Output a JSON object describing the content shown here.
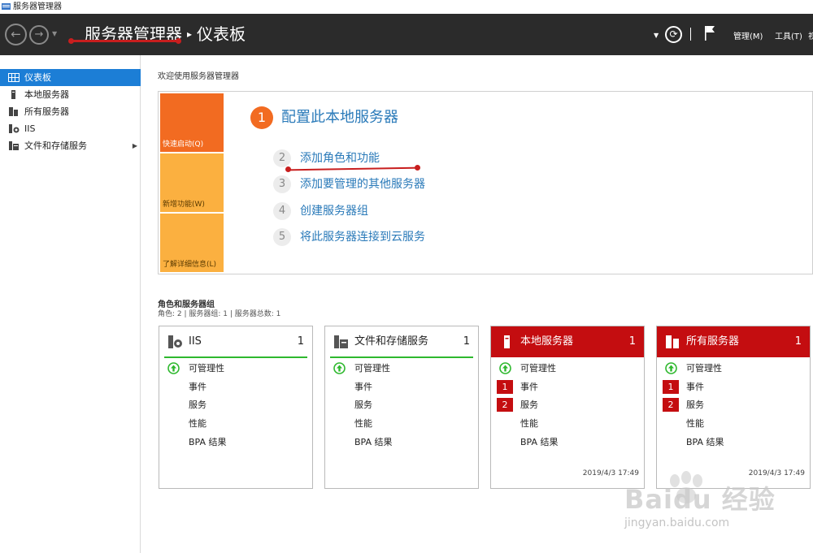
{
  "window": {
    "title": "服务器管理器"
  },
  "header": {
    "breadcrumb_root": "服务器管理器",
    "breadcrumb_sep": "▸",
    "breadcrumb_current": "仪表板",
    "menu_manage": "管理(M)",
    "menu_tools": "工具(T)",
    "menu_more": "视"
  },
  "sidebar": {
    "items": [
      {
        "label": "仪表板",
        "icon": "dashboard-icon",
        "active": true
      },
      {
        "label": "本地服务器",
        "icon": "server-icon"
      },
      {
        "label": "所有服务器",
        "icon": "servers-icon"
      },
      {
        "label": "IIS",
        "icon": "iis-icon"
      },
      {
        "label": "文件和存储服务",
        "icon": "storage-icon",
        "has_submenu": true
      }
    ]
  },
  "welcome": {
    "title": "欢迎使用服务器管理器",
    "tiles": {
      "quick_start": "快速启动(Q)",
      "whats_new": "新增功能(W)",
      "learn_more": "了解详细信息(L)"
    },
    "step1": {
      "num": "1",
      "label": "配置此本地服务器"
    },
    "steps": [
      {
        "num": "2",
        "label": "添加角色和功能"
      },
      {
        "num": "3",
        "label": "添加要管理的其他服务器"
      },
      {
        "num": "4",
        "label": "创建服务器组"
      },
      {
        "num": "5",
        "label": "将此服务器连接到云服务"
      }
    ]
  },
  "roles": {
    "title": "角色和服务器组",
    "summary": "角色: 2 | 服务器组: 1 | 服务器总数: 1",
    "cards": [
      {
        "name": "IIS",
        "count": "1",
        "status": "ok",
        "rows": [
          "可管理性",
          "事件",
          "服务",
          "性能",
          "BPA 结果"
        ],
        "badges": [
          "",
          "",
          "",
          "",
          ""
        ],
        "time": ""
      },
      {
        "name": "文件和存储服务",
        "count": "1",
        "status": "ok",
        "rows": [
          "可管理性",
          "事件",
          "服务",
          "性能",
          "BPA 结果"
        ],
        "badges": [
          "",
          "",
          "",
          "",
          ""
        ],
        "time": ""
      },
      {
        "name": "本地服务器",
        "count": "1",
        "status": "alert",
        "rows": [
          "可管理性",
          "事件",
          "服务",
          "性能",
          "BPA 结果"
        ],
        "badges": [
          "",
          "1",
          "2",
          "",
          ""
        ],
        "time": "2019/4/3 17:49"
      },
      {
        "name": "所有服务器",
        "count": "1",
        "status": "alert",
        "rows": [
          "可管理性",
          "事件",
          "服务",
          "性能",
          "BPA 结果"
        ],
        "badges": [
          "",
          "1",
          "2",
          "",
          ""
        ],
        "time": "2019/4/3 17:49"
      }
    ]
  },
  "watermark": {
    "brand": "Baidu 经验",
    "url": "jingyan.baidu.com"
  },
  "colors": {
    "accent_blue": "#1c7ed6",
    "link_blue": "#2a7ab9",
    "orange": "#f26b21",
    "amber": "#fbb040",
    "alert_red": "#c40d10",
    "ok_green": "#2eb82e",
    "header_dark": "#2b2b2b"
  }
}
